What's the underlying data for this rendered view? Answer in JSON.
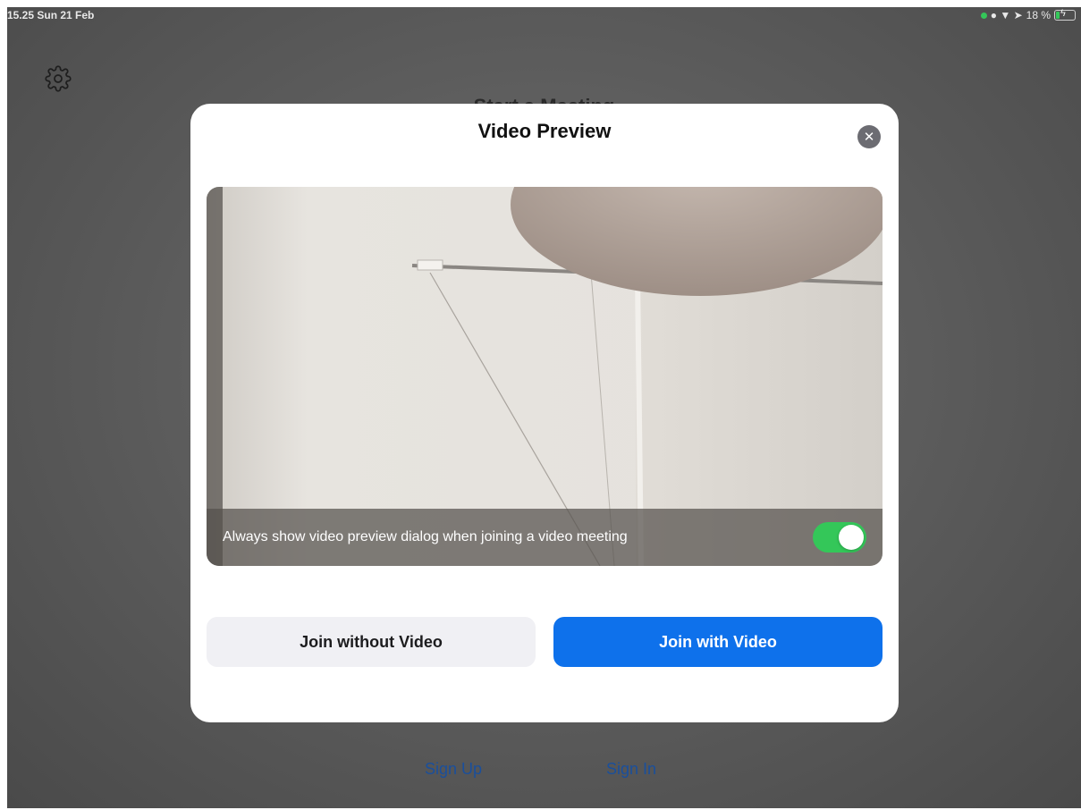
{
  "status_bar": {
    "time_date": "15.25  Sun 21 Feb",
    "signal_icons": "● ▼ ➤",
    "battery_text": "18 %"
  },
  "background": {
    "title": "Start a Meeting",
    "sign_up": "Sign Up",
    "sign_in": "Sign In"
  },
  "dialog": {
    "title": "Video Preview",
    "close_glyph": "✕",
    "preview_option_label": "Always show video preview dialog when joining a video meeting",
    "preview_option_enabled": true,
    "join_without_video": "Join without Video",
    "join_with_video": "Join with Video"
  },
  "colors": {
    "primary_button": "#0e71eb",
    "toggle_on": "#34c759",
    "link": "#1a4f9c"
  }
}
